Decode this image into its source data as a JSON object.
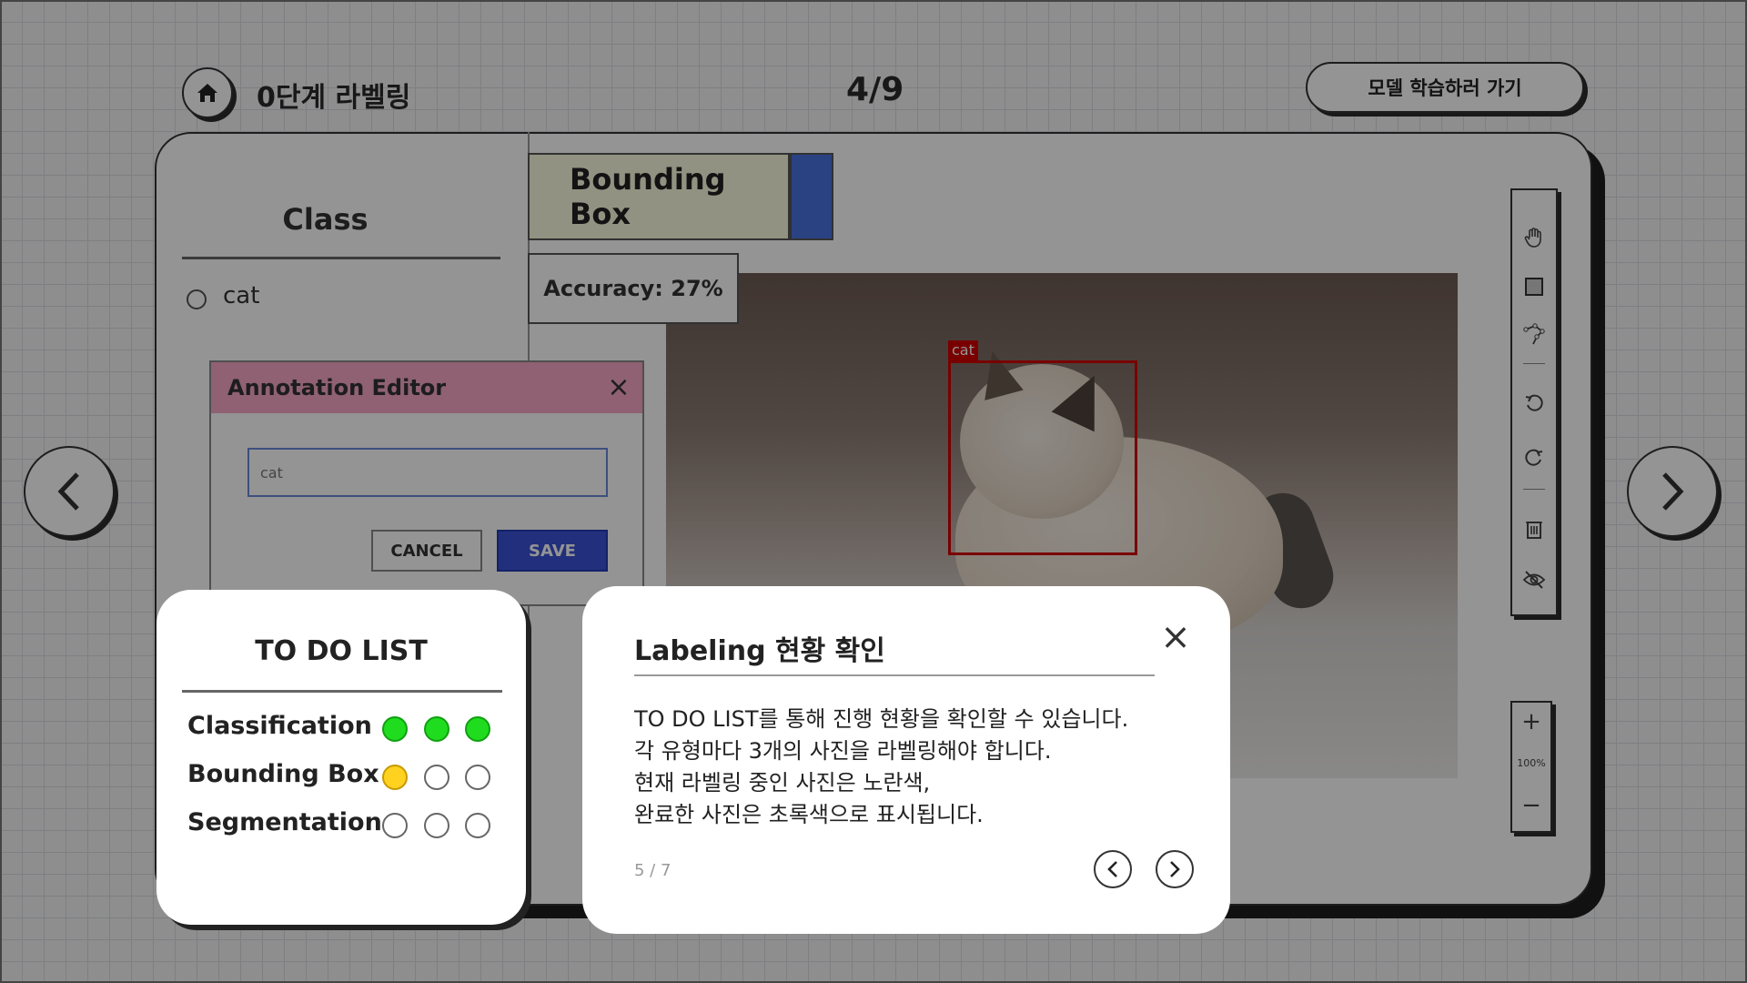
{
  "header": {
    "home_icon": "home-icon",
    "stage_title": "0단계 라벨링",
    "progress": "4/9",
    "go_training_label": "모델 학습하러 가기"
  },
  "class_panel": {
    "title": "Class",
    "classes": [
      {
        "label": "cat",
        "selected": false
      }
    ]
  },
  "tool_tab": {
    "label": "Bounding Box",
    "accent_color": "#4a72e0"
  },
  "accuracy": "Accuracy: 27%",
  "annotation": {
    "label": "cat",
    "box_color": "#d20000"
  },
  "toolbar": {
    "tools": [
      "hand-icon",
      "rectangle-icon",
      "polygon-icon",
      "undo-icon",
      "redo-icon",
      "delete-icon",
      "hide-icon"
    ]
  },
  "zoom": {
    "in_label": "+",
    "level": "100%",
    "out_label": "−"
  },
  "annotation_editor": {
    "title": "Annotation Editor",
    "input_value": "cat",
    "cancel_label": "CANCEL",
    "save_label": "SAVE",
    "header_color": "#f7a8c5"
  },
  "todo": {
    "title": "TO DO LIST",
    "rows": [
      {
        "label": "Classification",
        "status": [
          "done",
          "done",
          "done"
        ]
      },
      {
        "label": "Bounding Box",
        "status": [
          "current",
          "empty",
          "empty"
        ]
      },
      {
        "label": "Segmentation",
        "status": [
          "empty",
          "empty",
          "empty"
        ]
      }
    ],
    "colors": {
      "done": "#1fdc1f",
      "current": "#ffd21f"
    }
  },
  "tutorial": {
    "title": "Labeling 현황 확인",
    "lines": [
      "TO DO LIST를 통해 진행 현황을 확인할 수 있습니다.",
      "각 유형마다 3개의 사진을 라벨링해야 합니다.",
      "현재 라벨링 중인 사진은 노란색,",
      "완료한 사진은 초록색으로 표시됩니다."
    ],
    "page": "5 / 7"
  }
}
